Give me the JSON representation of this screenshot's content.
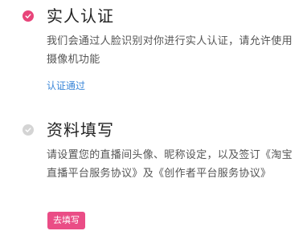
{
  "steps": [
    {
      "title": "实人认证",
      "description": "我们会通过人脸识别对你进行实人认证，请允许使用摄像机功能",
      "status_link": "认证通过",
      "state": "done",
      "icon": "check-icon",
      "icon_color": "#e8447a"
    },
    {
      "title": "资料填写",
      "description": "请设置您的直播间头像、昵称设定，以及签订《淘宝直播平台服务协议》及《创作者平台服务协议》",
      "button_label": "去填写",
      "state": "pending",
      "icon": "check-icon",
      "icon_color": "#d4d4d4"
    }
  ],
  "colors": {
    "accent": "#e8447a",
    "link": "#3a86d8",
    "muted": "#d4d4d4"
  }
}
